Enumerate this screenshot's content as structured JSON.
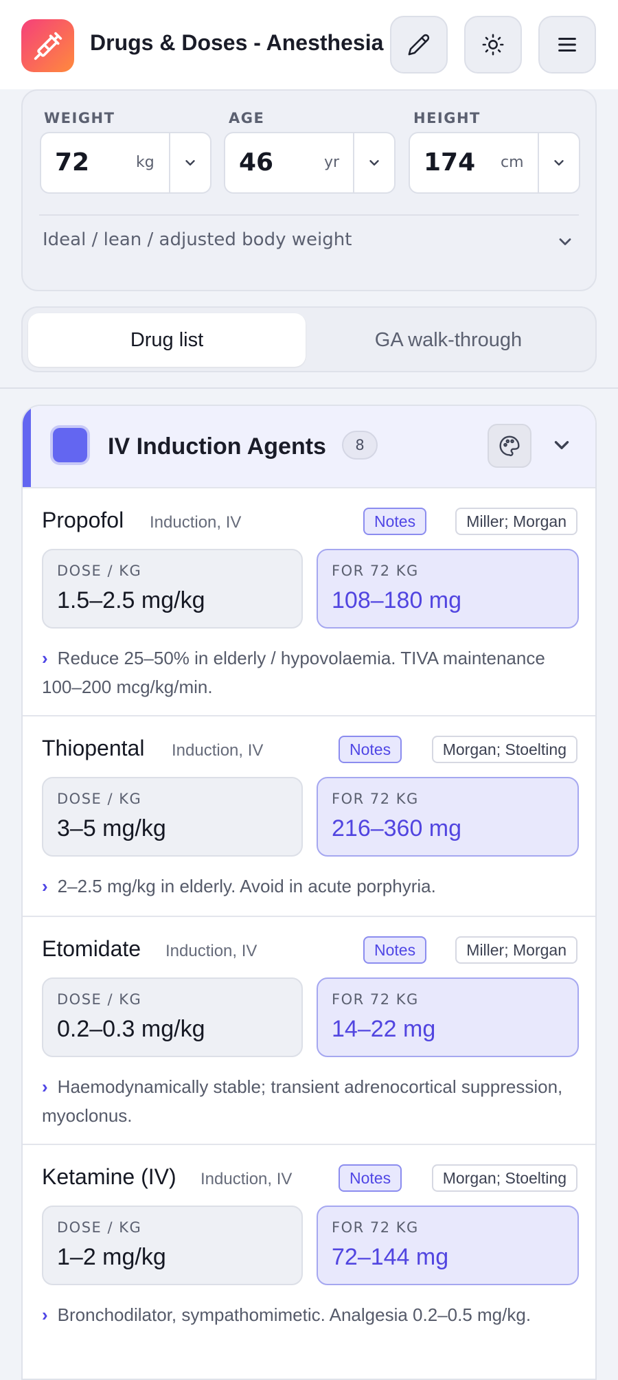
{
  "header": {
    "title": "Drugs & Doses - Anesthesia",
    "logo_icon": "syringe-icon",
    "actions": [
      "edit-icon",
      "sun-icon",
      "menu-icon"
    ]
  },
  "patient": {
    "weight": {
      "label": "WEIGHT",
      "value": "72",
      "unit": "kg"
    },
    "age": {
      "label": "AGE",
      "value": "46",
      "unit": "yr"
    },
    "height": {
      "label": "HEIGHT",
      "value": "174",
      "unit": "cm"
    },
    "body_weight_toggle": "Ideal / lean / adjusted body weight"
  },
  "tabs": {
    "active": "Drug list",
    "inactive": "GA walk-through"
  },
  "section": {
    "title": "IV Induction Agents",
    "count": "8",
    "color": "#6366f1"
  },
  "drugs": [
    {
      "name": "Propofol",
      "route": "Induction, IV",
      "notes_label": "Notes",
      "refs": "Miller; Morgan",
      "dose_label": "DOSE / KG",
      "dose": "1.5–2.5 mg/kg",
      "calc_label": "FOR 72 KG",
      "calc": "108–180 mg",
      "note": "Reduce 25–50% in elderly / hypovolaemia. TIVA maintenance 100–200 mcg/kg/min."
    },
    {
      "name": "Thiopental",
      "route": "Induction, IV",
      "notes_label": "Notes",
      "refs": "Morgan; Stoelting",
      "dose_label": "DOSE / KG",
      "dose": "3–5 mg/kg",
      "calc_label": "FOR 72 KG",
      "calc": "216–360 mg",
      "note": "2–2.5 mg/kg in elderly. Avoid in acute porphyria."
    },
    {
      "name": "Etomidate",
      "route": "Induction, IV",
      "notes_label": "Notes",
      "refs": "Miller; Morgan",
      "dose_label": "DOSE / KG",
      "dose": "0.2–0.3 mg/kg",
      "calc_label": "FOR 72 KG",
      "calc": "14–22 mg",
      "note": "Haemodynamically stable; transient adrenocortical suppression, myoclonus."
    },
    {
      "name": "Ketamine (IV)",
      "route": "Induction, IV",
      "notes_label": "Notes",
      "refs": "Morgan; Stoelting",
      "dose_label": "DOSE / KG",
      "dose": "1–2 mg/kg",
      "calc_label": "FOR 72 KG",
      "calc": "72–144 mg",
      "note": "Bronchodilator, sympathomimetic. Analgesia 0.2–0.5 mg/kg."
    }
  ]
}
